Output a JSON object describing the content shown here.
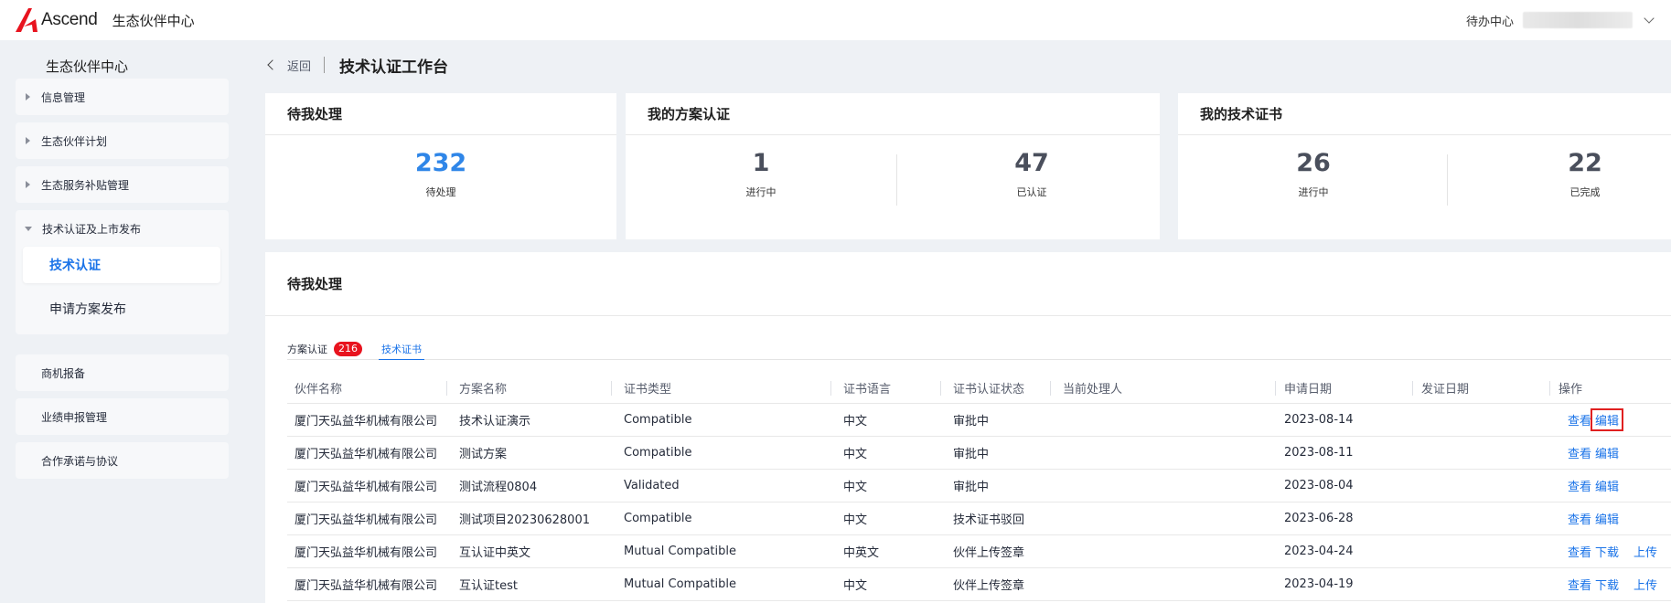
{
  "topbar": {
    "logo_text": "Ascend",
    "app_title": "生态伙伴中心",
    "todo_center": "待办中心",
    "brand_color": "#e8131e"
  },
  "sidebar": {
    "title": "生态伙伴中心",
    "items": [
      {
        "label": "信息管理"
      },
      {
        "label": "生态伙伴计划"
      },
      {
        "label": "生态服务补贴管理"
      },
      {
        "label": "技术认证及上市发布",
        "children": [
          {
            "label": "技术认证",
            "active": true
          },
          {
            "label": "申请方案发布"
          }
        ]
      },
      {
        "label": "商机报备"
      },
      {
        "label": "业绩申报管理"
      },
      {
        "label": "合作承诺与协议"
      }
    ]
  },
  "breadcrumb": {
    "back": "返回",
    "title": "技术认证工作台"
  },
  "cards": [
    {
      "title": "待我处理",
      "stats": [
        {
          "value": "232",
          "label": "待处理"
        }
      ]
    },
    {
      "title": "我的方案认证",
      "stats": [
        {
          "value": "1",
          "label": "进行中"
        },
        {
          "value": "47",
          "label": "已认证"
        }
      ]
    },
    {
      "title": "我的技术证书",
      "stats": [
        {
          "value": "26",
          "label": "进行中"
        },
        {
          "value": "22",
          "label": "已完成"
        }
      ]
    }
  ],
  "panel": {
    "title": "待我处理",
    "tabs": [
      {
        "label": "方案认证",
        "badge": "216"
      },
      {
        "label": "技术证书",
        "active": true
      }
    ],
    "columns": [
      "伙伴名称",
      "方案名称",
      "证书类型",
      "证书语言",
      "证书认证状态",
      "当前处理人",
      "申请日期",
      "发证日期",
      "操作"
    ],
    "rows": [
      {
        "partner": "厦门天弘益华机械有限公司",
        "solution": "技术认证演示",
        "type": "Compatible",
        "lang": "中文",
        "status": "审批中",
        "handler": "",
        "apply_date": "2023-08-14",
        "issue_date": "",
        "actions": [
          "查看",
          "编辑"
        ]
      },
      {
        "partner": "厦门天弘益华机械有限公司",
        "solution": "测试方案",
        "type": "Compatible",
        "lang": "中文",
        "status": "审批中",
        "handler": "",
        "apply_date": "2023-08-11",
        "issue_date": "",
        "actions": [
          "查看",
          "编辑"
        ]
      },
      {
        "partner": "厦门天弘益华机械有限公司",
        "solution": "测试流程0804",
        "type": "Validated",
        "lang": "中文",
        "status": "审批中",
        "handler": "",
        "apply_date": "2023-08-04",
        "issue_date": "",
        "actions": [
          "查看",
          "编辑"
        ]
      },
      {
        "partner": "厦门天弘益华机械有限公司",
        "solution": "测试项目20230628001",
        "type": "Compatible",
        "lang": "中文",
        "status": "技术证书驳回",
        "handler": "",
        "apply_date": "2023-06-28",
        "issue_date": "",
        "actions": [
          "查看",
          "编辑"
        ]
      },
      {
        "partner": "厦门天弘益华机械有限公司",
        "solution": "互认证中英文",
        "type": "Mutual Compatible",
        "lang": "中英文",
        "status": "伙伴上传签章",
        "handler": "",
        "apply_date": "2023-04-24",
        "issue_date": "",
        "actions": [
          "查看",
          "下载",
          "上传"
        ]
      },
      {
        "partner": "厦门天弘益华机械有限公司",
        "solution": "互认证test",
        "type": "Mutual Compatible",
        "lang": "中文",
        "status": "伙伴上传签章",
        "handler": "",
        "apply_date": "2023-04-19",
        "issue_date": "",
        "actions": [
          "查看",
          "下载",
          "上传"
        ]
      }
    ]
  }
}
